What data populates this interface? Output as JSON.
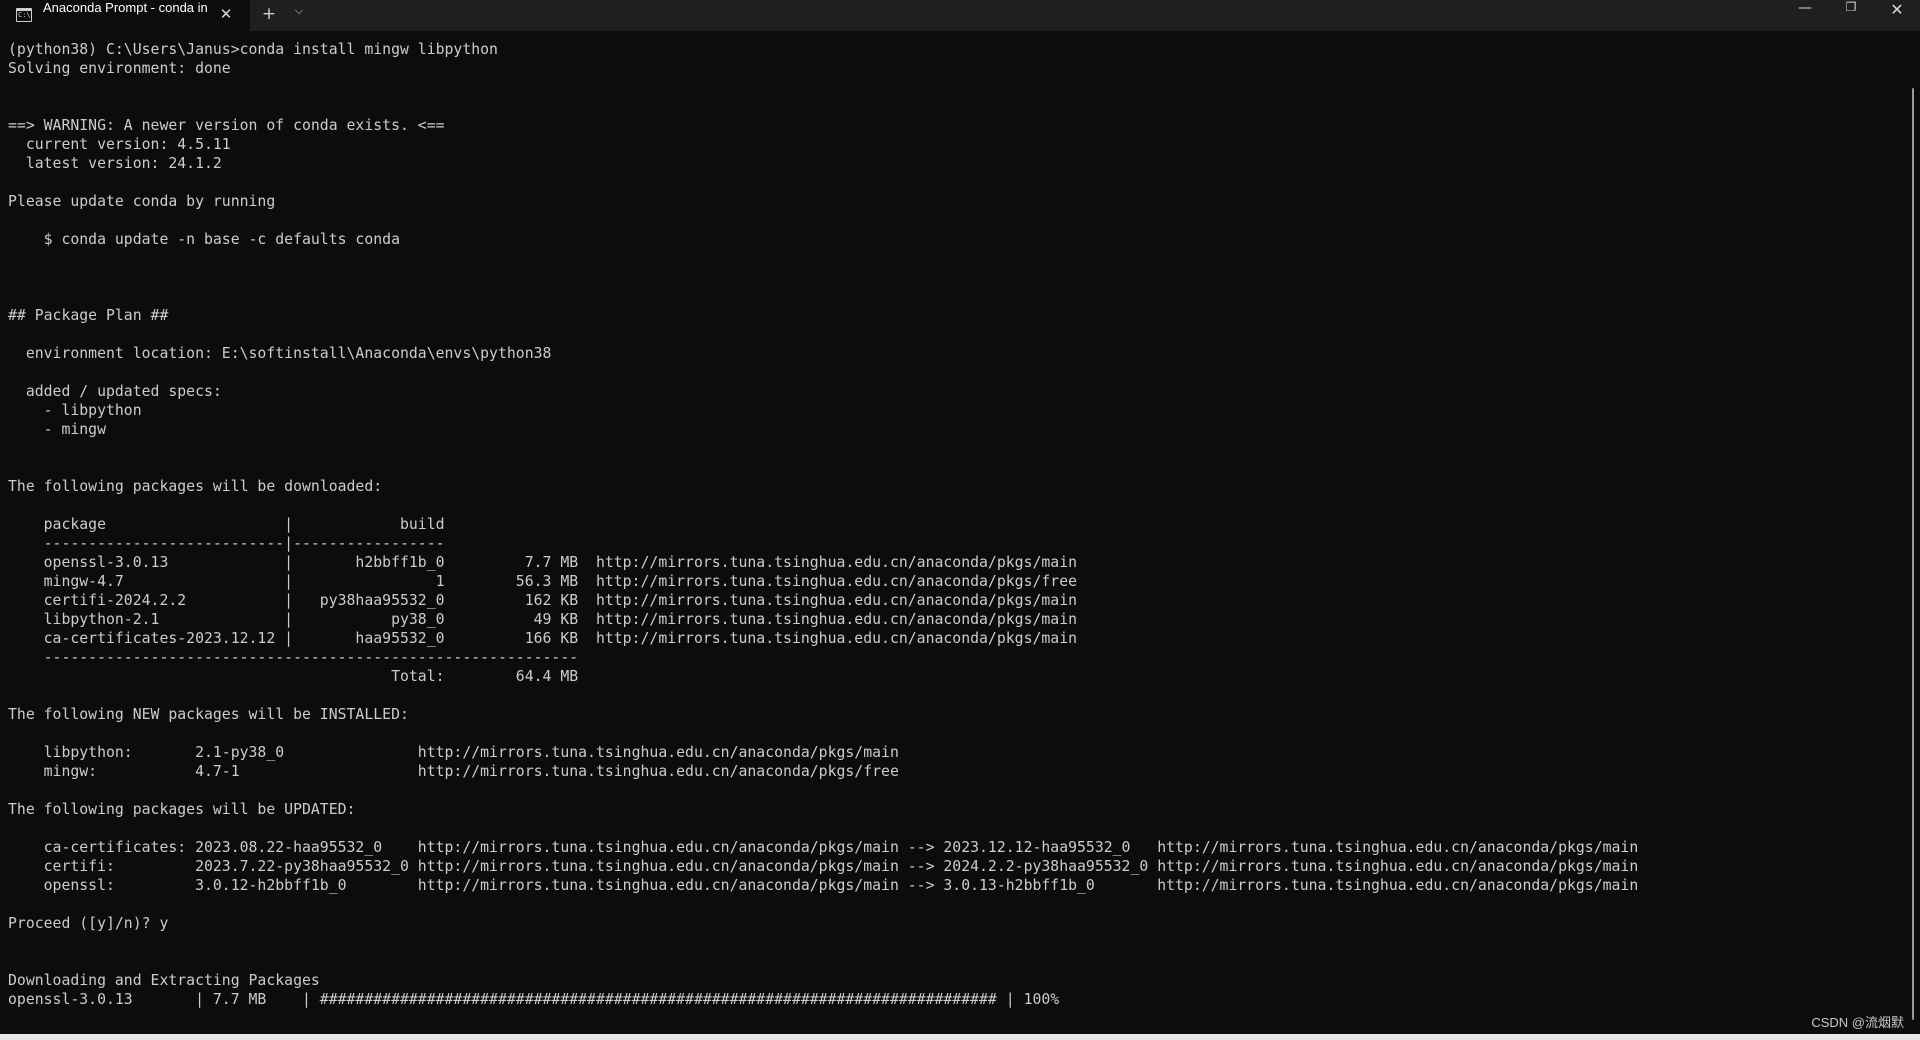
{
  "titlebar": {
    "tab_icon_glyph": "C:\\",
    "tab_title": "Anaconda Prompt - conda  in",
    "tab_close_icon": "close-icon",
    "new_tab_icon": "plus-icon",
    "dropdown_icon": "chevron-down-icon",
    "window_controls": {
      "minimize_icon": "minimize-icon",
      "maximize_icon": "restore-icon",
      "close_icon": "close-icon"
    }
  },
  "terminal": {
    "lines": [
      "(python38) C:\\Users\\Janus>conda install mingw libpython",
      "Solving environment: done",
      "",
      "",
      "==> WARNING: A newer version of conda exists. <==",
      "  current version: 4.5.11",
      "  latest version: 24.1.2",
      "",
      "Please update conda by running",
      "",
      "    $ conda update -n base -c defaults conda",
      "",
      "",
      "",
      "## Package Plan ##",
      "",
      "  environment location: E:\\softinstall\\Anaconda\\envs\\python38",
      "",
      "  added / updated specs:",
      "    - libpython",
      "    - mingw",
      "",
      "",
      "The following packages will be downloaded:",
      "",
      "    package                    |            build",
      "    ---------------------------|-----------------",
      "    openssl-3.0.13             |       h2bbff1b_0         7.7 MB  http://mirrors.tuna.tsinghua.edu.cn/anaconda/pkgs/main",
      "    mingw-4.7                  |                1        56.3 MB  http://mirrors.tuna.tsinghua.edu.cn/anaconda/pkgs/free",
      "    certifi-2024.2.2           |   py38haa95532_0         162 KB  http://mirrors.tuna.tsinghua.edu.cn/anaconda/pkgs/main",
      "    libpython-2.1              |           py38_0          49 KB  http://mirrors.tuna.tsinghua.edu.cn/anaconda/pkgs/main",
      "    ca-certificates-2023.12.12 |       haa95532_0         166 KB  http://mirrors.tuna.tsinghua.edu.cn/anaconda/pkgs/main",
      "    ------------------------------------------------------------",
      "                                           Total:        64.4 MB",
      "",
      "The following NEW packages will be INSTALLED:",
      "",
      "    libpython:       2.1-py38_0               http://mirrors.tuna.tsinghua.edu.cn/anaconda/pkgs/main",
      "    mingw:           4.7-1                    http://mirrors.tuna.tsinghua.edu.cn/anaconda/pkgs/free",
      "",
      "The following packages will be UPDATED:",
      "",
      "    ca-certificates: 2023.08.22-haa95532_0    http://mirrors.tuna.tsinghua.edu.cn/anaconda/pkgs/main --> 2023.12.12-haa95532_0   http://mirrors.tuna.tsinghua.edu.cn/anaconda/pkgs/main",
      "    certifi:         2023.7.22-py38haa95532_0 http://mirrors.tuna.tsinghua.edu.cn/anaconda/pkgs/main --> 2024.2.2-py38haa95532_0 http://mirrors.tuna.tsinghua.edu.cn/anaconda/pkgs/main",
      "    openssl:         3.0.12-h2bbff1b_0        http://mirrors.tuna.tsinghua.edu.cn/anaconda/pkgs/main --> 3.0.13-h2bbff1b_0       http://mirrors.tuna.tsinghua.edu.cn/anaconda/pkgs/main",
      "",
      "Proceed ([y]/n)? y",
      "",
      "",
      "Downloading and Extracting Packages",
      "openssl-3.0.13       | 7.7 MB    | ############################################################################ | 100%"
    ]
  },
  "download_progress": {
    "package": "openssl-3.0.13",
    "size": "7.7 MB",
    "percent": "100%"
  },
  "watermark": "CSDN @流烟默",
  "colors": {
    "terminal_bg": "#0c0c0c",
    "terminal_fg": "#cccccc",
    "titlebar_bg": "#1f1f1f"
  }
}
